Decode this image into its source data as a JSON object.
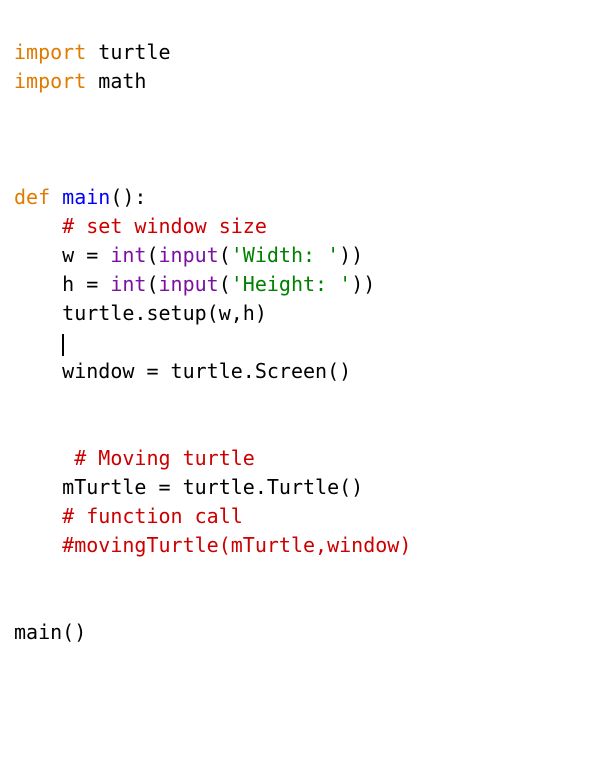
{
  "colors": {
    "keyword": "#e07b00",
    "def": "#0000ff",
    "comment": "#cc0000",
    "builtin": "#7b11a1",
    "string": "#008000",
    "text": "#000000",
    "background": "#ffffff"
  },
  "code": {
    "lines": [
      [
        {
          "t": "import",
          "cls": "keyword"
        },
        {
          "t": " turtle",
          "cls": "text"
        }
      ],
      [
        {
          "t": "import",
          "cls": "keyword"
        },
        {
          "t": " math",
          "cls": "text"
        }
      ],
      [],
      [],
      [],
      [
        {
          "t": "def",
          "cls": "keyword"
        },
        {
          "t": " ",
          "cls": "text"
        },
        {
          "t": "main",
          "cls": "def"
        },
        {
          "t": "():",
          "cls": "text"
        }
      ],
      [
        {
          "t": "    ",
          "cls": "text"
        },
        {
          "t": "# set window size",
          "cls": "comment"
        }
      ],
      [
        {
          "t": "    w = ",
          "cls": "text"
        },
        {
          "t": "int",
          "cls": "builtin"
        },
        {
          "t": "(",
          "cls": "text"
        },
        {
          "t": "input",
          "cls": "builtin"
        },
        {
          "t": "(",
          "cls": "text"
        },
        {
          "t": "'Width: '",
          "cls": "string"
        },
        {
          "t": "))",
          "cls": "text"
        }
      ],
      [
        {
          "t": "    h = ",
          "cls": "text"
        },
        {
          "t": "int",
          "cls": "builtin"
        },
        {
          "t": "(",
          "cls": "text"
        },
        {
          "t": "input",
          "cls": "builtin"
        },
        {
          "t": "(",
          "cls": "text"
        },
        {
          "t": "'Height: '",
          "cls": "string"
        },
        {
          "t": "))",
          "cls": "text"
        }
      ],
      [
        {
          "t": "    turtle.setup(w,h)",
          "cls": "text"
        }
      ],
      [
        {
          "t": "    ",
          "cls": "text"
        },
        {
          "cursor": true
        }
      ],
      [
        {
          "t": "    window = turtle.Screen()",
          "cls": "text"
        }
      ],
      [],
      [],
      [
        {
          "t": "     ",
          "cls": "text"
        },
        {
          "t": "# Moving turtle",
          "cls": "comment"
        }
      ],
      [
        {
          "t": "    mTurtle = turtle.Turtle()",
          "cls": "text"
        }
      ],
      [
        {
          "t": "    ",
          "cls": "text"
        },
        {
          "t": "# function call",
          "cls": "comment"
        }
      ],
      [
        {
          "t": "    ",
          "cls": "text"
        },
        {
          "t": "#movingTurtle(mTurtle,window)",
          "cls": "comment"
        }
      ],
      [],
      [],
      [
        {
          "t": "main()",
          "cls": "text"
        }
      ]
    ]
  }
}
